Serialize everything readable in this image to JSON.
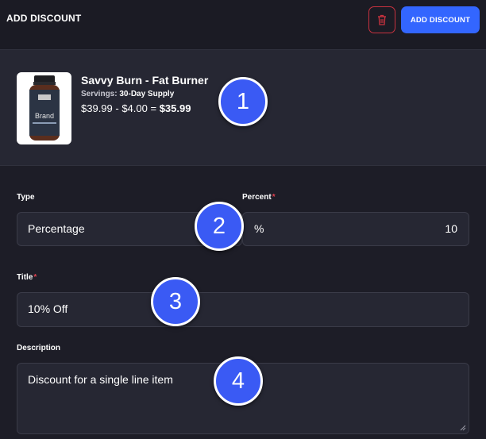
{
  "header": {
    "title": "ADD DISCOUNT",
    "add_button_label": "ADD DISCOUNT"
  },
  "product": {
    "name": "Savvy Burn - Fat Burner",
    "servings_label": "Servings:",
    "servings_value": "30-Day Supply",
    "price_original": "$39.99",
    "price_discount": "$4.00",
    "price_final": "$35.99",
    "image_label": "Brand"
  },
  "form": {
    "type_label": "Type",
    "type_value": "Percentage",
    "percent_label": "Percent",
    "percent_symbol": "%",
    "percent_value": "10",
    "title_label": "Title",
    "title_value": "10% Off",
    "description_label": "Description",
    "description_value": "Discount for a single line item",
    "required_mark": "*"
  },
  "annotations": [
    "1",
    "2",
    "3",
    "4"
  ],
  "colors": {
    "accent": "#3366ff",
    "danger": "#c8323f",
    "background": "#1d1d27",
    "panel": "#262733",
    "badge": "#3a5af4"
  }
}
